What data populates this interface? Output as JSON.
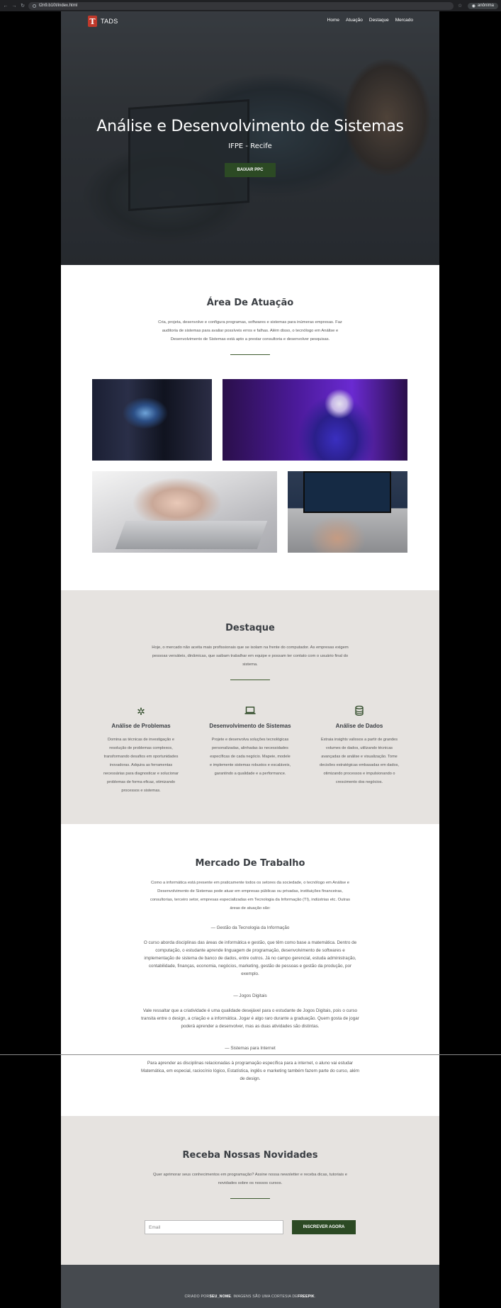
{
  "browser": {
    "url": "t2n9.b10t/index.html",
    "profile": "anônima"
  },
  "header": {
    "logo_letter": "T",
    "brand": "TADS",
    "nav": [
      "Home",
      "Atuação",
      "Destaque",
      "Mercado"
    ]
  },
  "hero": {
    "title": "Análise e Desenvolvimento de Sistemas",
    "subtitle": "IFPE - Recife",
    "button": "BAIXAR PPC"
  },
  "atuacao": {
    "title": "Área De Atuação",
    "text": "Cria, projeta, desenvolve e configura programas, softwares e sistemas para inúmeras empresas. Faz auditoria de sistemas para avaliar possíveis erros e falhas. Além disso, o tecnólogo em Análise e Desenvolvimento de Sistemas está apto a prestar consultoria e desenvolver pesquisas."
  },
  "destaque": {
    "title": "Destaque",
    "text": "Hoje, o mercado não aceita mais profissionais que se isolam na frente do computador. As empresas exigem pessoas versáteis, dinâmicas, que saibam trabalhar em equipe e possam ter contato com o usuário final do sistema.",
    "features": [
      {
        "icon": "gear-icon",
        "title": "Análise de Problemas",
        "text": "Domina as técnicas de investigação e resolução de problemas complexos, transformando desafios em oportunidades inovadoras. Adquira as ferramentas necessárias para diagnosticar e solucionar problemas de forma eficaz, otimizando processos e sistemas."
      },
      {
        "icon": "laptop-icon",
        "title": "Desenvolvimento de Sistemas",
        "text": "Projete e desenvolva soluções tecnológicas personalizadas, alinhadas às necessidades específicas de cada negócio. Mapeie, modele e implemente sistemas robustos e escaláveis, garantindo a qualidade e a performance."
      },
      {
        "icon": "database-icon",
        "title": "Análise de Dados",
        "text": "Extraia insights valiosos a partir de grandes volumes de dados, utilizando técnicas avançadas de análise e visualização. Tome decisões estratégicas embasadas em dados, otimizando processos e impulsionando o crescimento dos negócios."
      }
    ]
  },
  "mercado": {
    "title": "Mercado De Trabalho",
    "intro": "Como a informática está presente em praticamente todos os setores da sociedade, o tecnólogo em Análise e Desenvolvimento de Sistemas pode atuar em empresas públicas ou privadas, instituições financeiras, consultorias, terceiro setor, empresas especializadas em Tecnologia da Informação (TI), indústrias etc. Outras áreas de atuação são:",
    "areas": [
      {
        "heading": "— Gestão da Tecnologia da Informação",
        "text": "O curso aborda disciplinas das áreas de informática e gestão, que têm como base a matemática. Dentro de computação, o estudante aprende linguagem de programação, desenvolvimento de softwares e implementação de sistema de banco de dados, entre outros. Já no campo gerencial, estuda administração, contabilidade, finanças, economia, negócios, marketing, gestão de pessoas e gestão da produção, por exemplo."
      },
      {
        "heading": "— Jogos Digitais",
        "text": "Vale ressaltar que a criatividade é uma qualidade desejável para o estudante de Jogos Digitais, pois o curso transita entre o design, a criação e a informática. Jogar é algo raro durante a graduação. Quem gosta de jogar poderá aprender a desenvolver, mas as duas atividades são distintas."
      },
      {
        "heading": "— Sistemas para Internet",
        "text": "Para aprender as disciplinas relacionadas à programação específica para a internet, o aluno vai estudar Matemática, em especial, raciocínio lógico, Estatística, inglês e marketing também fazem parte do curso, além de design."
      }
    ]
  },
  "newsletter": {
    "title": "Receba Nossas Novidades",
    "text": "Quer aprimorar seus conhecimentos em programação? Assine nossa newsletter e receba dicas, tutoriais e novidades sobre os nossos cursos.",
    "placeholder": "Email",
    "button": "INSCREVER AGORA"
  },
  "footer": {
    "prefix": "CRIADO POR ",
    "author": "SEU_NOME",
    "middle": ". IMAGENS SÃO UMA CORTESIA DE ",
    "source": "FREEPIK",
    "suffix": "."
  }
}
